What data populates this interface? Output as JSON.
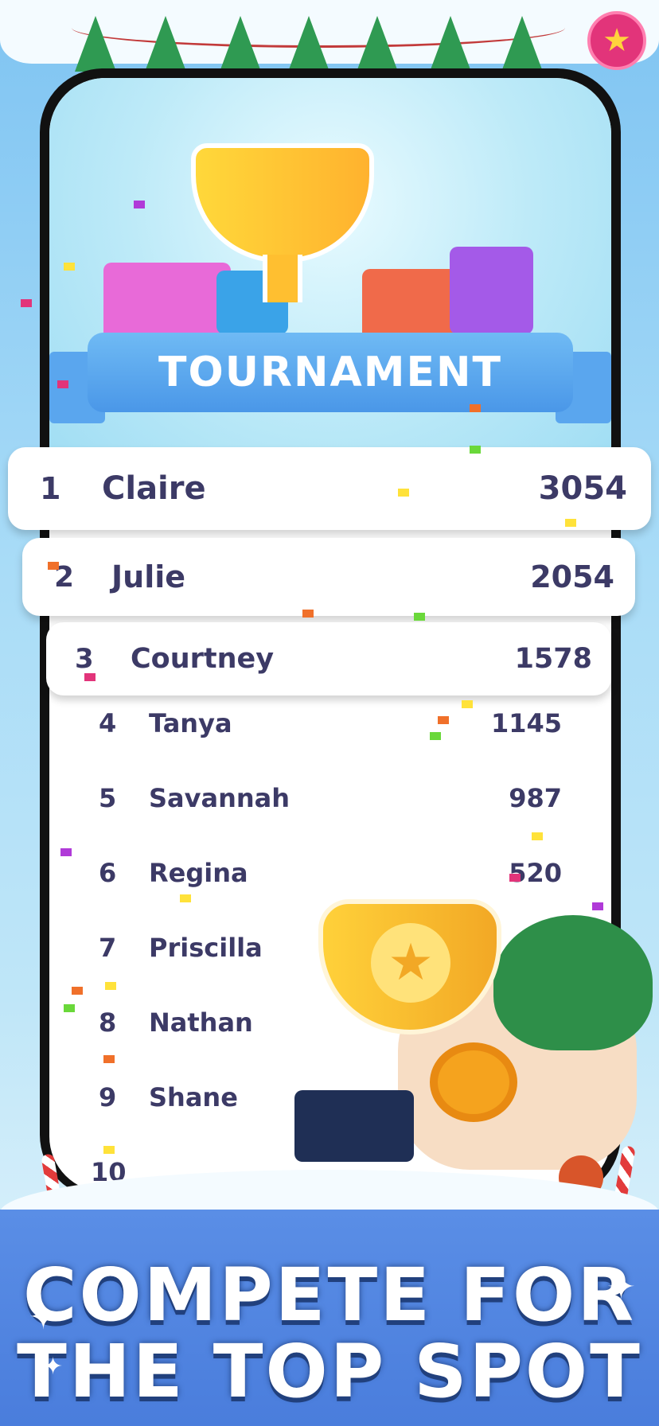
{
  "banner": {
    "title": "TOURNAMENT"
  },
  "top_rows": [
    {
      "rank": "1",
      "name": "Claire",
      "score": "3054"
    },
    {
      "rank": "2",
      "name": "Julie",
      "score": "2054"
    },
    {
      "rank": "3",
      "name": "Courtney",
      "score": "1578"
    }
  ],
  "rows": [
    {
      "rank": "4",
      "name": "Tanya",
      "score": "1145"
    },
    {
      "rank": "5",
      "name": "Savannah",
      "score": "987"
    },
    {
      "rank": "6",
      "name": "Regina",
      "score": "520"
    },
    {
      "rank": "7",
      "name": "Priscilla",
      "score": ""
    },
    {
      "rank": "8",
      "name": "Nathan",
      "score": ""
    },
    {
      "rank": "9",
      "name": "Shane",
      "score": ""
    },
    {
      "rank": "10",
      "name": "",
      "score": ""
    }
  ],
  "headline": {
    "line1": "COMPETE FOR",
    "line2": "THE TOP SPOT"
  },
  "colors": {
    "text_dark": "#3c3a66",
    "banner_blue": "#4a97e8",
    "panel_blue": "#4a7ddc",
    "gold": "#ffc430"
  },
  "icons": {
    "badge": "star-icon",
    "sparkle": "sparkle-icon"
  }
}
